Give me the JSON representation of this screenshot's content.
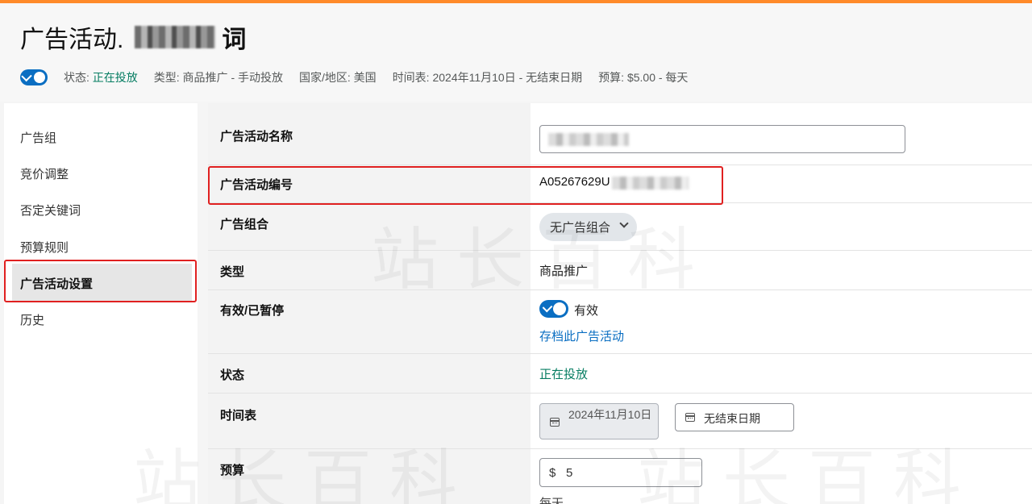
{
  "header": {
    "title_prefix": "广告活动.",
    "title_tail": "词",
    "status_label": "状态:",
    "status_value": "正在投放",
    "type": "类型: 商品推广 - 手动投放",
    "country": "国家/地区: 美国",
    "schedule": "时间表: 2024年11月10日 - 无结束日期",
    "budget": "预算: $5.00 - 每天"
  },
  "sidebar": {
    "items": [
      {
        "label": "广告组"
      },
      {
        "label": "竞价调整"
      },
      {
        "label": "否定关键词"
      },
      {
        "label": "预算规则"
      },
      {
        "label": "广告活动设置"
      },
      {
        "label": "历史"
      }
    ]
  },
  "settings": {
    "campaign_name_label": "广告活动名称",
    "campaign_id_label": "广告活动编号",
    "campaign_id_value": "A05267629U",
    "portfolio_label": "广告组合",
    "portfolio_value": "无广告组合",
    "type_label": "类型",
    "type_value": "商品推广",
    "active_label": "有效/已暂停",
    "active_value": "有效",
    "archive_link": "存档此广告活动",
    "status_label": "状态",
    "status_value": "正在投放",
    "schedule_label": "时间表",
    "start_date": "2024年11月10日",
    "end_date": "无结束日期",
    "budget_label": "预算",
    "budget_currency": "$",
    "budget_value": "5",
    "budget_period": "每天"
  },
  "watermark": "站长百科",
  "colors": {
    "accent_blue": "#0a6ec2",
    "status_green": "#067d62",
    "highlight_red": "#e02020",
    "top_bar_orange": "#ff8a2a"
  }
}
